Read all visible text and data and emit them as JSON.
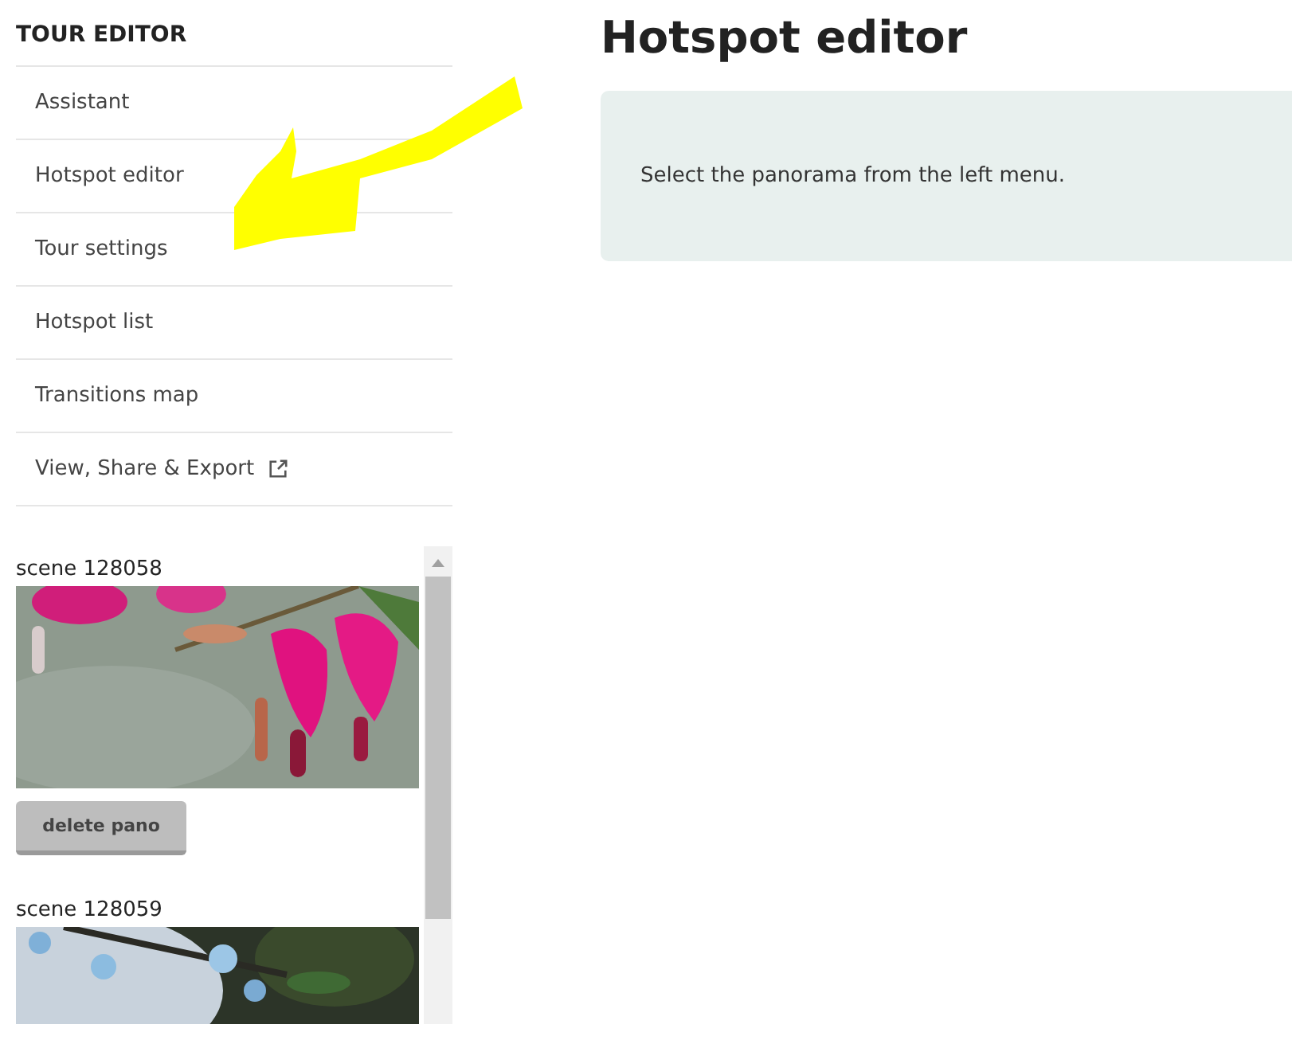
{
  "sidebar": {
    "title": "TOUR EDITOR",
    "items": [
      {
        "label": "Assistant",
        "external": false
      },
      {
        "label": "Hotspot editor",
        "external": false
      },
      {
        "label": "Tour settings",
        "external": false
      },
      {
        "label": "Hotspot list",
        "external": false
      },
      {
        "label": "Transitions map",
        "external": false
      },
      {
        "label": "View, Share & Export",
        "external": true
      }
    ],
    "scenes": [
      {
        "name": "scene 128058",
        "delete_button": "delete pano"
      },
      {
        "name": "scene 128059"
      }
    ]
  },
  "main": {
    "heading": "Hotspot editor",
    "message": "Select the panorama from the left menu."
  }
}
